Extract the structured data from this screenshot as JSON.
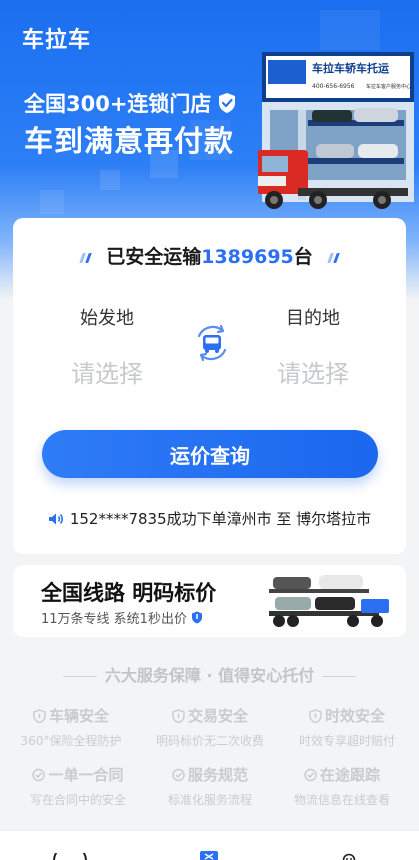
{
  "hero": {
    "brand": "车拉车",
    "tagline1": "全国300+连锁门店",
    "tagline2": "车到满意再付款",
    "store_sign": "车拉车轿车托运",
    "store_phone": "400-656-6956",
    "store_sub": "车拉车客户服务中心"
  },
  "card": {
    "stat_prefix": "已安全运输",
    "stat_number": "1389695",
    "stat_suffix": "台",
    "origin_label": "始发地",
    "origin_value": "请选择",
    "dest_label": "目的地",
    "dest_value": "请选择",
    "query_button": "运价查询",
    "ticker": "152****7835成功下单漳州市 至 博尔塔拉市"
  },
  "route": {
    "title": "全国线路 明码标价",
    "subtitle": "11万条专线 系统1秒出价"
  },
  "services": {
    "title": "六大服务保障 · 值得安心托付",
    "items": [
      {
        "title": "车辆安全",
        "desc": "360°保险全程防护",
        "icon": "shield-icon"
      },
      {
        "title": "交易安全",
        "desc": "明码标价无二次收费",
        "icon": "shield-icon"
      },
      {
        "title": "时效安全",
        "desc": "时效专享超时赔付",
        "icon": "shield-icon"
      },
      {
        "title": "一单一合同",
        "desc": "写在合同中的安全",
        "icon": "check-circle-icon"
      },
      {
        "title": "服务规范",
        "desc": "标准化服务流程",
        "icon": "check-circle-icon"
      },
      {
        "title": "在途跟踪",
        "desc": "物流信息在线查看",
        "icon": "check-circle-icon"
      }
    ]
  },
  "colors": {
    "primary": "#2b6ff2",
    "hero_top": "#1b6ff0",
    "muted": "#c9cbcf"
  }
}
